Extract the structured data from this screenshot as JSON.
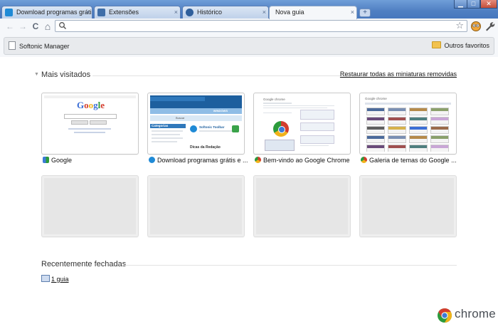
{
  "window": {
    "buttons": {
      "minimize": "▁",
      "maximize": "□",
      "close": "✕"
    }
  },
  "tabs": [
    {
      "title": "Download programas grátis,...",
      "favicon_color": "#1f8ad6",
      "active": false
    },
    {
      "title": "Extensões",
      "favicon_color": "#3f6ea8",
      "active": false
    },
    {
      "title": "Histórico",
      "favicon_color": "#2f5f9b",
      "active": false
    },
    {
      "title": "Nova guia",
      "favicon_color": "",
      "active": true
    }
  ],
  "tab_close_glyph": "×",
  "new_tab_glyph": "+",
  "toolbar": {
    "back_glyph": "←",
    "forward_glyph": "→",
    "reload_glyph": "C",
    "home_glyph": "⌂",
    "omnibox_value": "",
    "star_glyph": "☆",
    "wrench_glyph": "🔧"
  },
  "bookmarks": {
    "items": [
      {
        "label": "Softonic Manager",
        "icon": "page-icon"
      }
    ],
    "other_folder": "Outros favoritos"
  },
  "most_visited": {
    "title": "Mais visitados",
    "restore_link": "Restaurar todas as miniaturas removidas",
    "items": [
      {
        "caption": "Google",
        "favicon_color": "#3c7bd6"
      },
      {
        "caption": "Download programas grátis e ...",
        "favicon_color": "#1f8ad6"
      },
      {
        "caption": "Bem-vindo ao Google Chrome",
        "favicon_color": "#d64a2f"
      },
      {
        "caption": "Galeria de temas do Google ...",
        "favicon_color": "#d64a2f"
      }
    ],
    "thumb_texts": {
      "google_logo": "Google",
      "softonic_section": "Categorias",
      "softonic_toolbar": "Softonic Toolbar",
      "softonic_dicas": "Dicas da Redação",
      "softonic_windows": "WINDOWS",
      "softonic_search": "Buscar",
      "chrome_page_brand": "Google chrome",
      "theme_page_brand": "Google chrome"
    }
  },
  "recently_closed": {
    "title": "Recentemente fechadas",
    "link": "1 guia"
  },
  "branding": {
    "wordmark": "chrome"
  }
}
